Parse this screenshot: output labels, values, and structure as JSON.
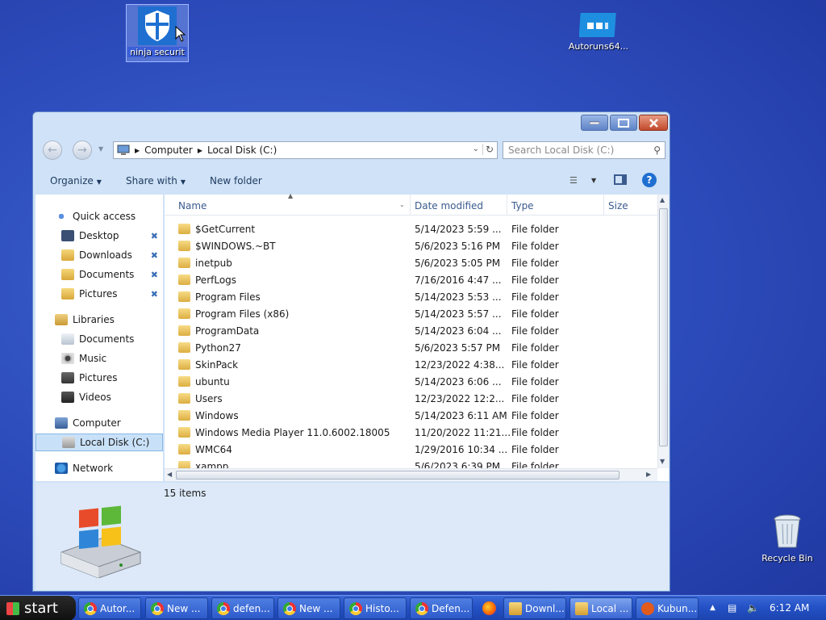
{
  "desktop": {
    "icons": [
      {
        "label": "ninja securit"
      },
      {
        "label": "Autoruns64..."
      },
      {
        "label": "Recycle Bin"
      }
    ]
  },
  "window": {
    "address": {
      "crumbs": [
        "Computer",
        "Local Disk (C:)"
      ]
    },
    "search_placeholder": "Search Local Disk (C:)",
    "commands": {
      "organize": "Organize",
      "share": "Share with",
      "new_folder": "New folder"
    },
    "nav": {
      "quick_access": "Quick access",
      "quick_items": [
        "Desktop",
        "Downloads",
        "Documents",
        "Pictures"
      ],
      "libraries": "Libraries",
      "library_items": [
        "Documents",
        "Music",
        "Pictures",
        "Videos"
      ],
      "computer": "Computer",
      "computer_items": [
        "Local Disk (C:)"
      ],
      "network": "Network"
    },
    "columns": {
      "name": "Name",
      "date": "Date modified",
      "type": "Type",
      "size": "Size"
    },
    "files": [
      {
        "name": "$GetCurrent",
        "date": "5/14/2023 5:59 ...",
        "type": "File folder"
      },
      {
        "name": "$WINDOWS.~BT",
        "date": "5/6/2023 5:16 PM",
        "type": "File folder"
      },
      {
        "name": "inetpub",
        "date": "5/6/2023 5:05 PM",
        "type": "File folder"
      },
      {
        "name": "PerfLogs",
        "date": "7/16/2016 4:47 ...",
        "type": "File folder"
      },
      {
        "name": "Program Files",
        "date": "5/14/2023 5:53 ...",
        "type": "File folder"
      },
      {
        "name": "Program Files (x86)",
        "date": "5/14/2023 5:57 ...",
        "type": "File folder"
      },
      {
        "name": "ProgramData",
        "date": "5/14/2023 6:04 ...",
        "type": "File folder"
      },
      {
        "name": "Python27",
        "date": "5/6/2023 5:57 PM",
        "type": "File folder"
      },
      {
        "name": "SkinPack",
        "date": "12/23/2022 4:38...",
        "type": "File folder"
      },
      {
        "name": "ubuntu",
        "date": "5/14/2023 6:06 ...",
        "type": "File folder"
      },
      {
        "name": "Users",
        "date": "12/23/2022 12:2...",
        "type": "File folder"
      },
      {
        "name": "Windows",
        "date": "5/14/2023 6:11 AM",
        "type": "File folder"
      },
      {
        "name": "Windows Media Player 11.0.6002.18005",
        "date": "11/20/2022 11:21...",
        "type": "File folder"
      },
      {
        "name": "WMC64",
        "date": "1/29/2016 10:34 ...",
        "type": "File folder"
      },
      {
        "name": "xampp",
        "date": "5/6/2023 6:39 PM",
        "type": "File folder"
      }
    ],
    "status": {
      "item_count": "15 items"
    }
  },
  "taskbar": {
    "start_label": "start",
    "buttons": [
      {
        "label": "Autor..."
      },
      {
        "label": "New ..."
      },
      {
        "label": "defen..."
      },
      {
        "label": "New ..."
      },
      {
        "label": "Histo..."
      },
      {
        "label": "Defen..."
      },
      {
        "label": "Downl..."
      },
      {
        "label": "Local ..."
      },
      {
        "label": "Kubun..."
      }
    ],
    "clock": "6:12 AM"
  }
}
